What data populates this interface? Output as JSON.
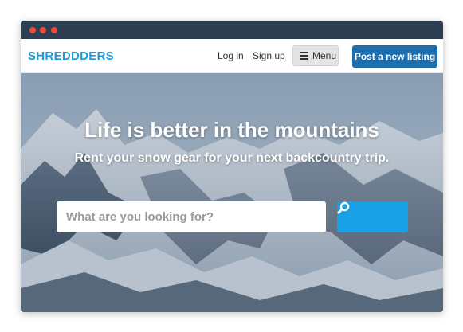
{
  "navbar": {
    "logo": "SHREDDDERS",
    "login_label": "Log in",
    "signup_label": "Sign up",
    "menu_label": "Menu",
    "post_listing_label": "Post a new listing"
  },
  "hero": {
    "title": "Life is better in the mountains",
    "subtitle": "Rent your snow gear for your next backcountry trip.",
    "search_placeholder": "What are you looking for?"
  },
  "icons": {
    "menu": "hamburger-icon",
    "search": "search-icon"
  },
  "colors": {
    "titlebar": "#2c3e50",
    "window_dots": "#e74c3c",
    "brand": "#1a9bdc",
    "post_button": "#1c6fae",
    "search_button": "#1aa0e6"
  }
}
